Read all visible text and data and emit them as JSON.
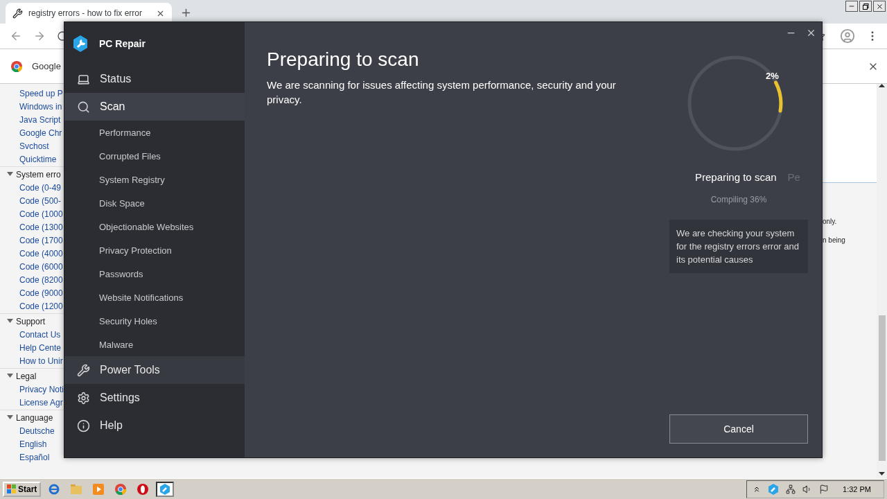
{
  "browser": {
    "tab": {
      "title": "registry errors - how to fix error",
      "selected": true
    },
    "infobar": {
      "label": "Google"
    },
    "page": {
      "nav": [
        {
          "children": [
            "Speed up P",
            "Windows in",
            "Java Script",
            "Google Chr",
            "Svchost",
            "Quicktime"
          ]
        },
        {
          "label": "System erro",
          "expanded": true,
          "children": [
            "Code (0-49",
            "Code (500-",
            "Code (1000",
            "Code (1300",
            "Code (1700",
            "Code (4000",
            "Code (6000",
            "Code (8200",
            "Code (9000",
            "Code (1200"
          ]
        },
        {
          "label": "Support",
          "expanded": true,
          "children": [
            "Contact Us",
            "Help Cente",
            "How to Unir"
          ]
        },
        {
          "label": "Legal",
          "expanded": true,
          "children": [
            "Privacy Noti",
            "License Agr"
          ]
        },
        {
          "label": "Language",
          "expanded": true,
          "children": [
            "Deutsche",
            "English",
            "Español"
          ]
        }
      ],
      "fragments": [
        "only.",
        "n being"
      ]
    }
  },
  "app": {
    "title": "PC Repair",
    "nav": [
      {
        "label": "Status",
        "kind": "laptop",
        "selected": false,
        "highlighted": false
      },
      {
        "label": "Scan",
        "kind": "search",
        "selected": true,
        "highlighted": false,
        "children": [
          {
            "label": "Performance",
            "selected": false
          },
          {
            "label": "Corrupted Files",
            "selected": false
          },
          {
            "label": "System Registry",
            "selected": false
          },
          {
            "label": "Disk Space",
            "selected": false
          },
          {
            "label": "Objectionable Websites",
            "selected": false
          },
          {
            "label": "Privacy Protection",
            "selected": false
          },
          {
            "label": "Passwords",
            "selected": false
          },
          {
            "label": "Website Notifications",
            "selected": false
          },
          {
            "label": "Security Holes",
            "selected": false
          },
          {
            "label": "Malware",
            "selected": false
          }
        ]
      },
      {
        "label": "Power Tools",
        "kind": "wrench",
        "selected": false,
        "highlighted": true
      },
      {
        "label": "Settings",
        "kind": "gear",
        "selected": false,
        "highlighted": false
      },
      {
        "label": "Help",
        "kind": "info",
        "selected": false,
        "highlighted": false
      }
    ],
    "heading": "Preparing to scan",
    "description": "We are scanning for issues affecting system performance, security and your privacy.",
    "progress": {
      "percent": "2%",
      "stage": "Preparing to scan",
      "next_stage": "Pe",
      "detail": "Compiling 36%",
      "info": "We are checking your system for the registry errors error and its potential causes"
    },
    "cancel": "Cancel"
  },
  "taskbar": {
    "start": "Start",
    "apps": [
      {
        "kind": "ie",
        "active": false
      },
      {
        "kind": "folder",
        "active": false
      },
      {
        "kind": "media",
        "active": false
      },
      {
        "kind": "chrome",
        "active": false
      },
      {
        "kind": "opera",
        "active": false
      },
      {
        "kind": "repair",
        "active": true
      }
    ],
    "clock": "1:32 PM"
  }
}
